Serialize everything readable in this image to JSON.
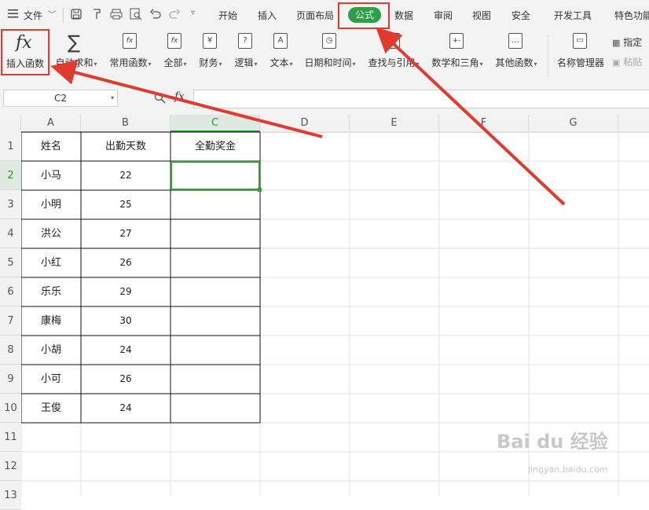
{
  "menubar": {
    "file_label": "文件",
    "tabs": [
      "开始",
      "插入",
      "页面布局",
      "公式",
      "数据",
      "审阅",
      "视图",
      "安全",
      "开发工具",
      "特色功能"
    ],
    "active_tab": "公式",
    "accent_color": "#2f9e48"
  },
  "ribbon": {
    "insert_function": "插入函数",
    "autosum": "自动求和",
    "common_functions": "常用函数",
    "all": "全部",
    "finance": "财务",
    "logic": "逻辑",
    "text": "文本",
    "datetime": "日期和时间",
    "lookup": "查找与引用",
    "math": "数学和三角",
    "other": "其他函数",
    "name_manager": "名称管理器",
    "specify": "指定",
    "paste": "粘贴"
  },
  "formula_bar": {
    "name_box": "C2",
    "fx_label": "fx",
    "value": ""
  },
  "sheet": {
    "columns": [
      "A",
      "B",
      "C",
      "D",
      "E",
      "F",
      "G"
    ],
    "rows": [
      "1",
      "2",
      "3",
      "4",
      "5",
      "6",
      "7",
      "8",
      "9",
      "10",
      "11",
      "12",
      "13"
    ],
    "active_cell": "C2",
    "headers": [
      "姓名",
      "出勤天数",
      "全勤奖金"
    ],
    "data": [
      {
        "name": "小马",
        "days": "22"
      },
      {
        "name": "小明",
        "days": "25"
      },
      {
        "name": "洪公",
        "days": "27"
      },
      {
        "name": "小红",
        "days": "26"
      },
      {
        "name": "乐乐",
        "days": "29"
      },
      {
        "name": "康梅",
        "days": "30"
      },
      {
        "name": "小胡",
        "days": "24"
      },
      {
        "name": "小可",
        "days": "26"
      },
      {
        "name": "王俊",
        "days": "24"
      }
    ]
  },
  "watermark": {
    "brand": "Bai du 经验",
    "url": "jingyan.baidu.com"
  },
  "annotation_color": "#e23a2e"
}
